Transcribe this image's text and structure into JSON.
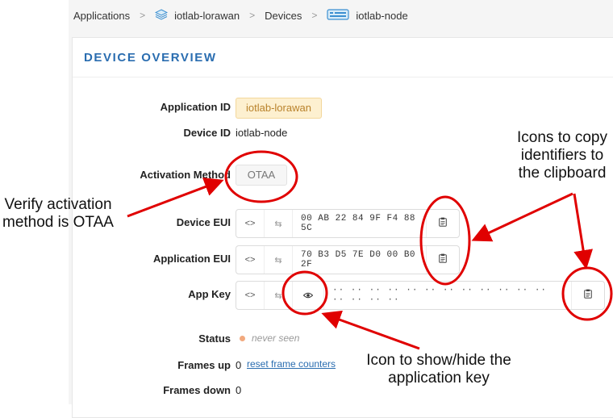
{
  "breadcrumb": {
    "applications": "Applications",
    "app": "iotlab-lorawan",
    "devices": "Devices",
    "device": "iotlab-node"
  },
  "panel": {
    "title": "DEVICE OVERVIEW"
  },
  "fields": {
    "application_id_label": "Application ID",
    "application_id": "iotlab-lorawan",
    "device_id_label": "Device ID",
    "device_id": "iotlab-node",
    "activation_method_label": "Activation Method",
    "activation_method": "OTAA",
    "device_eui_label": "Device EUI",
    "device_eui": "00 AB 22 84 9F F4 88 5C",
    "application_eui_label": "Application EUI",
    "application_eui": "70 B3 D5 7E D0 00 B0 2F",
    "app_key_label": "App Key",
    "app_key_masked": "·· ·· ·· ·· ·· ·· ·· ·· ·· ·· ·· ·· ·· ·· ·· ··",
    "status_label": "Status",
    "status": "never seen",
    "frames_up_label": "Frames up",
    "frames_up": "0",
    "reset_link": "reset frame counters",
    "frames_down_label": "Frames down",
    "frames_down": "0"
  },
  "buttons": {
    "code_toggle": "<>",
    "swap": "⇆"
  },
  "annotations": {
    "copy_icons_1": "Icons to copy",
    "copy_icons_2": "identifiers to",
    "copy_icons_3": "the clipboard",
    "verify_1": "Verify activation",
    "verify_2": "method is OTAA",
    "show_hide_1": "Icon to show/hide the",
    "show_hide_2": "application key"
  },
  "colors": {
    "accent": "#2a6db0",
    "annotation_red": "#e00000",
    "tag_bg": "#fdf0d0",
    "status_dot": "#f2a97e"
  }
}
